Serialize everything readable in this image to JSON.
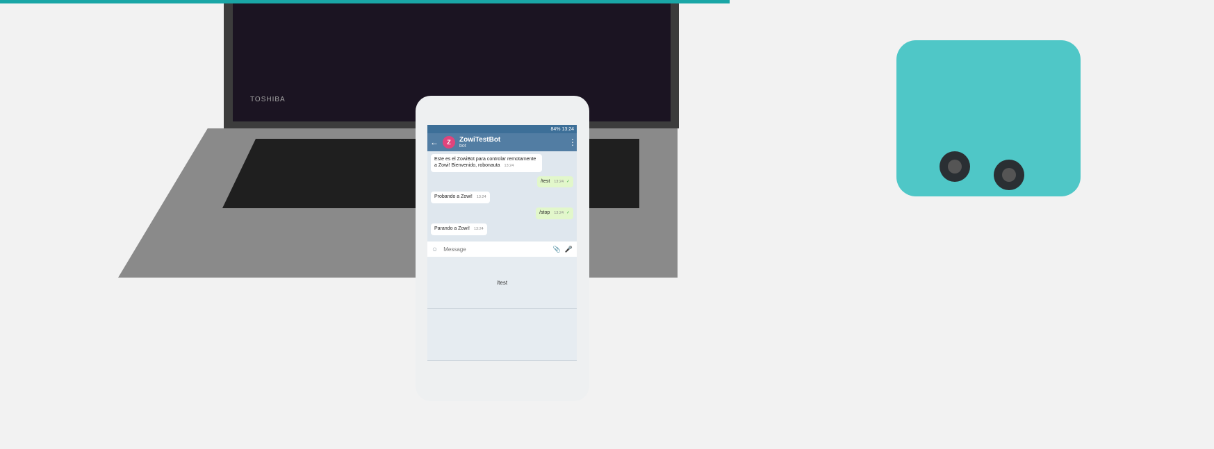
{
  "colors": {
    "accent_teal": "#1aa6a6",
    "robot_teal": "#4fc7c7",
    "chat_header": "#527da3",
    "avatar_pink": "#e0447c"
  },
  "laptop": {
    "brand": "TOSHIBA"
  },
  "phone": {
    "status": {
      "right": "84% 13:24"
    },
    "header": {
      "back_icon": "back-arrow-icon",
      "avatar_letter": "Z",
      "title": "ZowiTestBot",
      "subtitle": "bot",
      "menu_icon": "more-vert-icon"
    },
    "messages": [
      {
        "side": "in",
        "text": "Este es el ZowiBot para controlar remotamente a Zowi! Bienvenido, robonauta",
        "time": "13:24"
      },
      {
        "side": "out",
        "text": "/test",
        "time": "13:24"
      },
      {
        "side": "in",
        "text": "Probando a Zowi!",
        "time": "13:24"
      },
      {
        "side": "out",
        "text": "/stop",
        "time": "13:24"
      },
      {
        "side": "in",
        "text": "Parando a Zowi!",
        "time": "13:24"
      }
    ],
    "composer": {
      "placeholder": "Message",
      "emoji_icon": "emoji-icon",
      "attach_icon": "attach-icon",
      "mic_icon": "mic-icon"
    },
    "keyboard_buttons": [
      "/test",
      ""
    ]
  }
}
